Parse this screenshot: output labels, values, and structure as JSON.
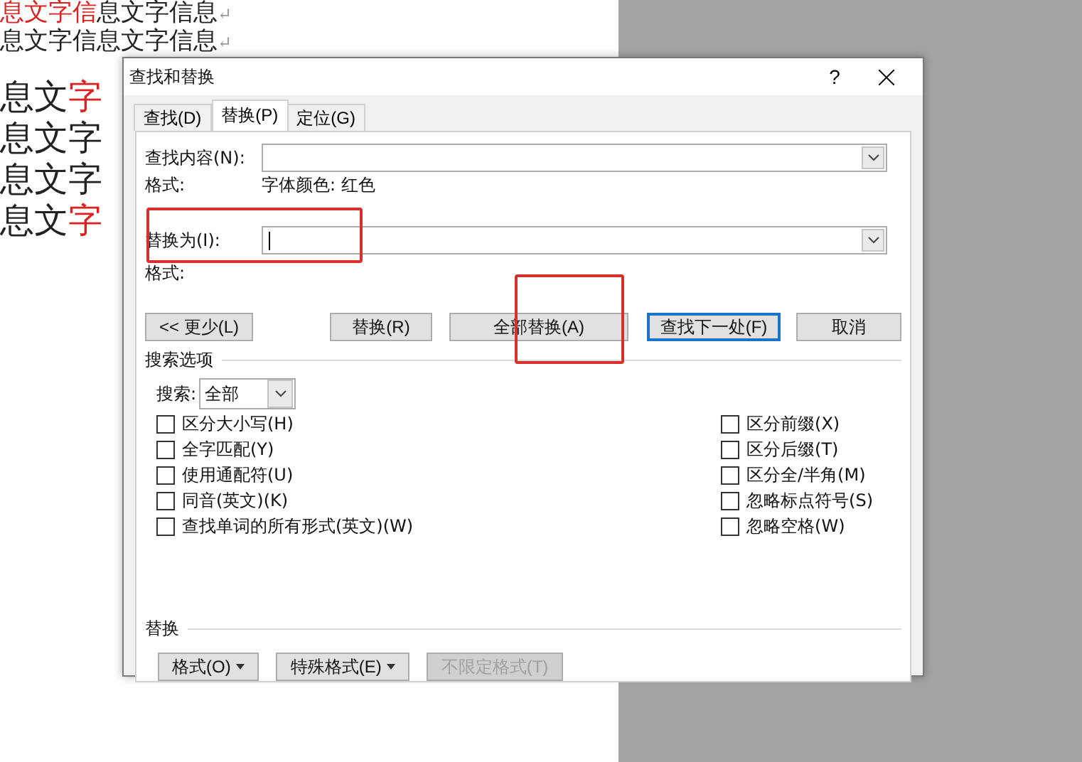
{
  "document": {
    "lines": [
      {
        "segments": [
          {
            "text": "息文字信",
            "color": "#e02020"
          },
          {
            "text": "息文字信息",
            "color": "#222222"
          }
        ],
        "paragraph_mark": "↵"
      },
      {
        "segments": [
          {
            "text": "息文字信息文字信息",
            "color": "#222222"
          }
        ],
        "paragraph_mark": "↵"
      },
      {
        "segments": [
          {
            "text": "息文",
            "color": "#222222"
          },
          {
            "text": "字",
            "color": "#e02020"
          }
        ]
      },
      {
        "segments": [
          {
            "text": "息文字",
            "color": "#222222"
          }
        ]
      },
      {
        "segments": [
          {
            "text": "息文字",
            "color": "#222222"
          }
        ]
      },
      {
        "segments": [
          {
            "text": "息文",
            "color": "#222222"
          },
          {
            "text": "字",
            "color": "#e02020"
          }
        ]
      }
    ]
  },
  "dialog": {
    "title": "查找和替换",
    "help": "?",
    "tabs": [
      {
        "label": "查找(D)",
        "selected": false
      },
      {
        "label": "替换(P)",
        "selected": true
      },
      {
        "label": "定位(G)",
        "selected": false
      }
    ],
    "find": {
      "label": "查找内容(N):",
      "format_label": "格式:",
      "format_value": "字体颜色: 红色"
    },
    "replace": {
      "label": "替换为(I):",
      "format_label": "格式:",
      "focused": true
    },
    "buttons": [
      {
        "label": "<< 更少(L)",
        "default": false
      },
      {
        "label": "替换(R)",
        "default": false
      },
      {
        "label": "全部替换(A)",
        "default": false
      },
      {
        "label": "查找下一处(F)",
        "default": true
      },
      {
        "label": "取消",
        "default": false
      }
    ],
    "search_options": {
      "heading": "搜索选项",
      "search_label": "搜索:",
      "search_value": "全部",
      "left": [
        {
          "label": "区分大小写(H)",
          "checked": false
        },
        {
          "label": "全字匹配(Y)",
          "checked": false
        },
        {
          "label": "使用通配符(U)",
          "checked": false
        },
        {
          "label": "同音(英文)(K)",
          "checked": false
        },
        {
          "label": "查找单词的所有形式(英文)(W)",
          "checked": false
        }
      ],
      "right": [
        {
          "label": "区分前缀(X)",
          "checked": false
        },
        {
          "label": "区分后缀(T)",
          "checked": false
        },
        {
          "label": "区分全/半角(M)",
          "checked": false
        },
        {
          "label": "忽略标点符号(S)",
          "checked": false
        },
        {
          "label": "忽略空格(W)",
          "checked": false
        }
      ]
    },
    "replace_section": {
      "heading": "替换",
      "buttons": [
        {
          "label": "格式(O)",
          "dropdown": true,
          "disabled": false
        },
        {
          "label": "特殊格式(E)",
          "dropdown": true,
          "disabled": false
        },
        {
          "label": "不限定格式(T)",
          "dropdown": false,
          "disabled": true
        }
      ]
    }
  }
}
